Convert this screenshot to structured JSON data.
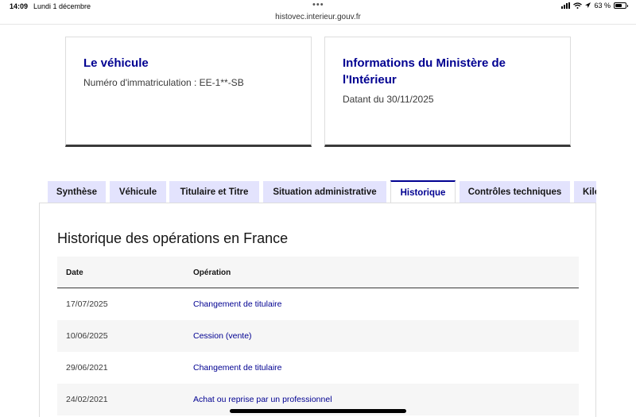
{
  "status_bar": {
    "time": "14:09",
    "date": "Lundi 1 décembre",
    "dots": "•••",
    "battery": "63 %",
    "url": "histovec.interieur.gouv.fr"
  },
  "card_vehicle": {
    "title": "Le véhicule",
    "plate_text": "Numéro d'immatriculation : EE-1**-SB"
  },
  "card_ministry": {
    "title_line1": "Informations du Ministère de",
    "title_line2": "l'Intérieur",
    "date_text": "Datant du 30/11/2025"
  },
  "tabs": [
    {
      "label": "Synthèse"
    },
    {
      "label": "Véhicule"
    },
    {
      "label": "Titulaire et Titre"
    },
    {
      "label": "Situation administrative"
    },
    {
      "label": "Historique"
    },
    {
      "label": "Contrôles techniques"
    },
    {
      "label": "Kilométrage"
    }
  ],
  "history": {
    "title": "Historique des opérations en France",
    "columns": {
      "date": "Date",
      "operation": "Opération"
    },
    "rows": [
      {
        "date": "17/07/2025",
        "operation": "Changement de titulaire"
      },
      {
        "date": "10/06/2025",
        "operation": "Cession (vente)"
      },
      {
        "date": "29/06/2021",
        "operation": "Changement de titulaire"
      },
      {
        "date": "24/02/2021",
        "operation": "Achat ou reprise par un professionnel"
      }
    ]
  },
  "colors": {
    "accent": "#000091",
    "tab_bg": "#e3e3fd",
    "row_alt": "#f6f6f6"
  }
}
